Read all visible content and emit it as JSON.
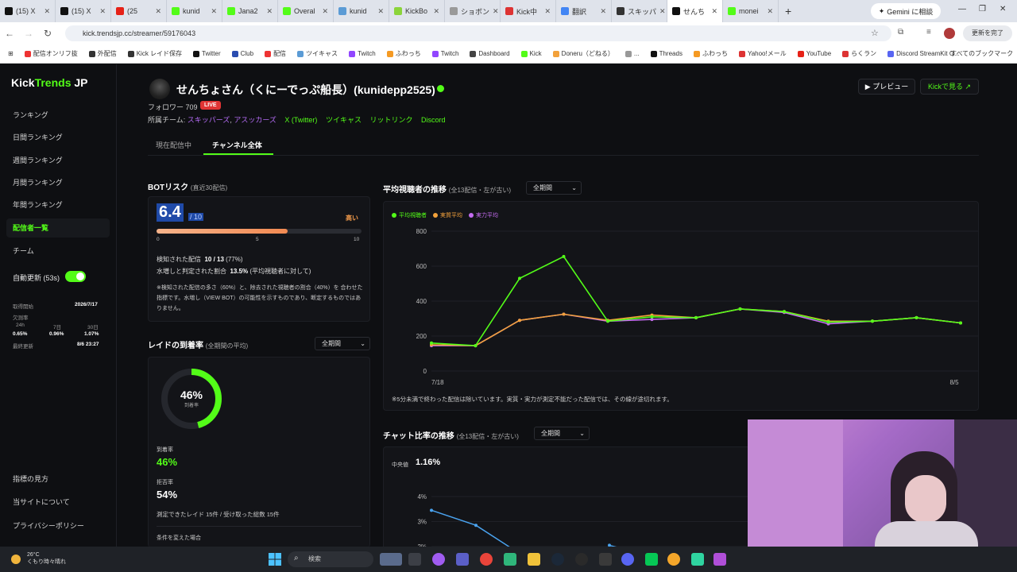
{
  "browser": {
    "tabs": [
      {
        "label": "(15) X",
        "color": "#111111"
      },
      {
        "label": "(15) X",
        "color": "#111111"
      },
      {
        "label": "(25",
        "color": "#e62117"
      },
      {
        "label": "kunid",
        "color": "#53fc18"
      },
      {
        "label": "Jana2",
        "color": "#53fc18"
      },
      {
        "label": "Overal",
        "color": "#53fc18"
      },
      {
        "label": "kunid",
        "color": "#5b9bd5"
      },
      {
        "label": "KickBo",
        "color": "#8bd43a"
      },
      {
        "label": "ショボン",
        "color": "#999999"
      },
      {
        "label": "Kick中",
        "color": "#d33"
      },
      {
        "label": "翻訳",
        "color": "#4285f4"
      },
      {
        "label": "スキッパ",
        "color": "#333333"
      },
      {
        "label": "せんち",
        "color": "#111111",
        "active": true
      },
      {
        "label": "monei",
        "color": "#53fc18"
      }
    ],
    "gemini_label": "Gemini に相談",
    "url": "kick.trendsjp.cc/streamer/59176043",
    "update_label": "更新を完了",
    "bookmarks": [
      "配信オンリフ抜",
      "外配信",
      "Kick レイド保存",
      "Twitter",
      "Club",
      "配信",
      "ツイキャス",
      "Twitch",
      "ふわっち",
      "Twitch",
      "Dashboard",
      "Kick",
      "Doneru（どねる）",
      "...",
      "Threads",
      "ふわっち",
      "Yahoo!メール",
      "YouTube",
      "らくラン",
      "Discord StreamKit O..."
    ],
    "bookmarks_right": "すべてのブックマーク"
  },
  "sidebar": {
    "logo_main": "Kick",
    "logo_accent": "Trends",
    "logo_suffix": " JP",
    "items": [
      "ランキング",
      "日間ランキング",
      "週間ランキング",
      "月間ランキング",
      "年間ランキング",
      "配信者一覧",
      "チーム"
    ],
    "active_index": 5,
    "auto_refresh": "自動更新 (53s)",
    "meta": {
      "start_label": "取得開始",
      "start_value": "2026/7/17",
      "missing_label": "欠測率",
      "h24": "24h",
      "d7": "7日",
      "d30": "30日",
      "v24": "0.65%",
      "v7": "0.96%",
      "v30": "1.07%",
      "updated_label": "最終更新",
      "updated_value": "8/6 23:27"
    },
    "footer": [
      "指標の見方",
      "当サイトについて",
      "プライバシーポリシー"
    ]
  },
  "channel": {
    "name": "せんちょさん（くにーでっぷ船長）(kunidepp2525)",
    "followers": "フォロワー 709",
    "live": "LIVE",
    "team_label": "所属チーム:",
    "team1": "スキッパーズ",
    "team_sep": ",",
    "team2": "アスッカーズ",
    "links": [
      "X (Twitter)",
      "ツイキャス",
      "リットリンク",
      "Discord"
    ],
    "preview_btn": "▶ プレビュー",
    "kick_btn": "Kickで見る ↗"
  },
  "tabs": {
    "current": "現在配信中",
    "all": "チャンネル全体"
  },
  "bot": {
    "title": "BOTリスク",
    "subtitle": "(直近30配信)",
    "score": "6.4",
    "max": "/ 10",
    "level": "高い",
    "score_value": 6.4,
    "score_max": 10,
    "ticks": [
      "0",
      "5",
      "10"
    ],
    "detected_label": "検知された配信",
    "detected_value": "10 / 13",
    "detected_pct": "(77%)",
    "inflated_label": "水増しと判定された割合",
    "inflated_value": "13.5%",
    "inflated_note": "(平均視聴者に対して)",
    "note": "※検知された配信の多さ（60%）と、除去された視聴者の割合（40%）を 合わせた指標です。水増し（VIEW BOT）の可能性を示すものであり、断定するものではありません。",
    "color_track": "#f28a52"
  },
  "raid": {
    "title": "レイドの到着率",
    "subtitle": "(全期間の平均)",
    "period": "全期間",
    "donut_value": "46%",
    "donut_label": "到着率",
    "donut_fraction": 0.46,
    "arrive_label": "到着率",
    "arrive_value": "46%",
    "reject_label": "拒否率",
    "reject_value": "54%",
    "measured": "測定できたレイド 15件 / 受け取った総数 15件",
    "cond": "条件を変えた場合"
  },
  "viewers": {
    "title": "平均視聴者の推移",
    "subtitle": "(全13配信・左が古い)",
    "period": "全期間",
    "note": "※5分未満で終わった配信は除いています。実質・実力が測定不能だった配信では、その線が途切れます。"
  },
  "chat": {
    "title": "チャット比率の推移",
    "subtitle": "(全13配信・左が古い)",
    "period": "全期間",
    "median_label": "中央値",
    "median_value": "1.16%"
  },
  "chart_data": [
    {
      "type": "line",
      "title": "平均視聴者の推移",
      "x": [
        "7/18",
        "",
        "",
        "",
        "",
        "",
        "",
        "",
        "",
        "",
        "",
        "",
        "8/5"
      ],
      "xticks": [
        "7/18",
        "8/5"
      ],
      "ylim": [
        0,
        800
      ],
      "yticks": [
        "0",
        "200",
        "400",
        "600",
        "800"
      ],
      "legend_position": "top-left",
      "series": [
        {
          "name": "平均視聴者",
          "color": "#53fc18",
          "values": [
            160,
            145,
            530,
            655,
            285,
            310,
            305,
            355,
            340,
            280,
            285,
            305,
            275
          ]
        },
        {
          "name": "実質平均",
          "color": "#f2a13b",
          "values": [
            150,
            145,
            290,
            325,
            290,
            320,
            305,
            355,
            340,
            285,
            285,
            305,
            275
          ]
        },
        {
          "name": "実力平均",
          "color": "#c46cf0",
          "values": [
            145,
            145,
            290,
            325,
            285,
            295,
            305,
            355,
            335,
            270,
            285,
            305,
            275
          ]
        }
      ],
      "grid": true
    },
    {
      "type": "line",
      "title": "チャット比率の推移",
      "ylim": [
        1.5,
        4
      ],
      "yticks": [
        "2%",
        "3%",
        "4%"
      ],
      "series": [
        {
          "name": "",
          "color": "#4aa3ef",
          "values": [
            3.45,
            2.85,
            1.7,
            null,
            2.05,
            1.6
          ]
        }
      ],
      "grid": true
    }
  ],
  "taskbar": {
    "temp": "26°C",
    "weather": "くもり時々晴れ",
    "search": "検索"
  }
}
